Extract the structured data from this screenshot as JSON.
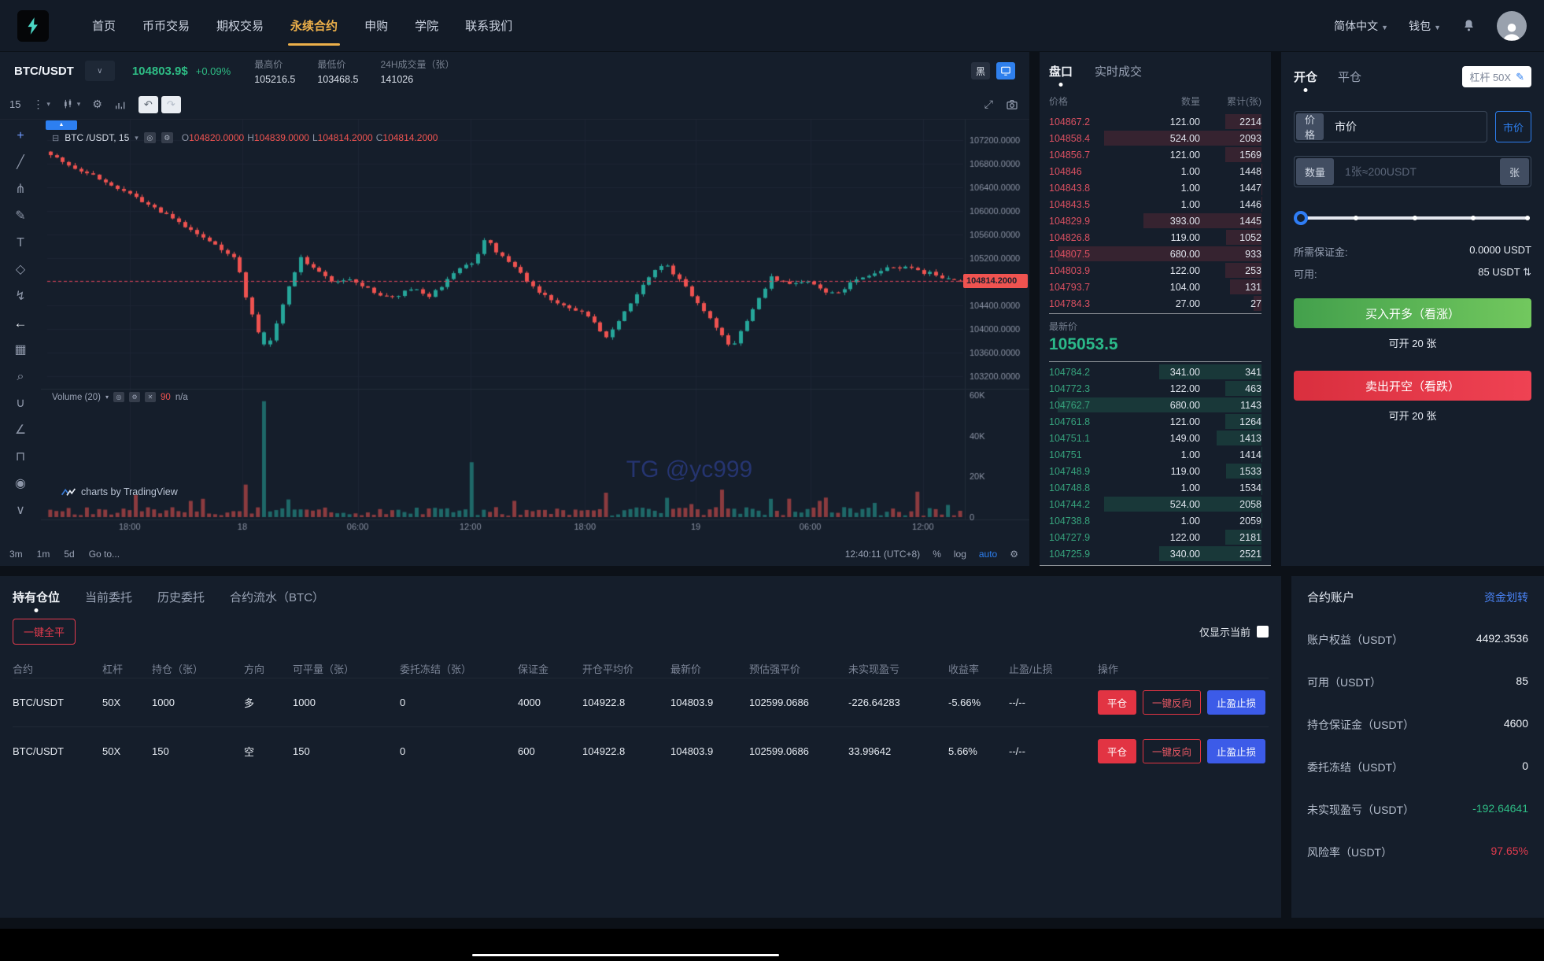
{
  "nav": {
    "items": [
      "首页",
      "币币交易",
      "期权交易",
      "永续合约",
      "申购",
      "学院",
      "联系我们"
    ],
    "active_index": 3,
    "language": "简体中文",
    "wallet": "钱包"
  },
  "symbol_header": {
    "pair": "BTC/USDT",
    "price": "104803.9$",
    "change": "+0.09%",
    "stats": [
      {
        "label": "最高价",
        "value": "105216.5"
      },
      {
        "label": "最低价",
        "value": "103468.5"
      },
      {
        "label": "24H成交量（张）",
        "value": "141026"
      }
    ],
    "theme_toggle": "黑"
  },
  "tv": {
    "interval": "15",
    "legend": {
      "title": "BTC /USDT, 15",
      "ohlc": [
        [
          "O",
          "104820.0000"
        ],
        [
          "H",
          "104839.0000"
        ],
        [
          "L",
          "104814.2000"
        ],
        [
          "C",
          "104814.2000"
        ]
      ]
    },
    "volume_legend": {
      "title": "Volume (20)",
      "value": "90",
      "na": "n/a"
    },
    "attribution": "charts by TradingView",
    "watermark": "TG @yc999",
    "price_tag": "104814.2000",
    "draw_tools": [
      {
        "name": "crosshair-tool-icon",
        "glyph": "+",
        "accent": true
      },
      {
        "name": "trend-line-tool-icon",
        "glyph": "╱"
      },
      {
        "name": "pitchfork-tool-icon",
        "glyph": "⋔"
      },
      {
        "name": "brush-tool-icon",
        "glyph": "✎"
      },
      {
        "name": "text-tool-icon",
        "glyph": "T"
      },
      {
        "name": "shapes-tool-icon",
        "glyph": "◇"
      },
      {
        "name": "forecast-tool-icon",
        "glyph": "↯"
      },
      {
        "name": "back-arrow-icon",
        "glyph": "←",
        "bright": true
      },
      {
        "name": "patterns-tool-icon",
        "glyph": "▦"
      },
      {
        "name": "zoom-tool-icon",
        "glyph": "⌕"
      },
      {
        "name": "magnet-tool-icon",
        "glyph": "∪"
      },
      {
        "name": "measure-tool-icon",
        "glyph": "∠"
      },
      {
        "name": "lock-tool-icon",
        "glyph": "⊓"
      },
      {
        "name": "hide-drawings-icon",
        "glyph": "◉"
      },
      {
        "name": "collapse-toolbar-icon",
        "glyph": "∨"
      }
    ],
    "bottom": {
      "ranges": [
        "3m",
        "1m",
        "5d",
        "Go to..."
      ],
      "clock": "12:40:11 (UTC+8)",
      "percent": "%",
      "log": "log",
      "auto": "auto"
    }
  },
  "chart_data": {
    "type": "candlestick+volume",
    "n_candles": 150,
    "seed": 7,
    "last_price": 104814.2,
    "price_ticks": [
      107200,
      106800,
      106400,
      106000,
      105600,
      105200,
      104800,
      104400,
      104000,
      103600,
      103200
    ],
    "volume_ticks": [
      [
        60000,
        "60K"
      ],
      [
        40000,
        "40K"
      ],
      [
        20000,
        "20K"
      ],
      [
        0,
        "0"
      ]
    ],
    "time_ticks": [
      [
        0.09,
        "18:00"
      ],
      [
        0.213,
        "18"
      ],
      [
        0.339,
        "06:00"
      ],
      [
        0.462,
        "12:00"
      ],
      [
        0.587,
        "18:00"
      ],
      [
        0.708,
        "19"
      ],
      [
        0.833,
        "06:00"
      ],
      [
        0.956,
        "12:00"
      ]
    ],
    "waypoints": [
      [
        0,
        106980
      ],
      [
        0.02,
        106780
      ],
      [
        0.045,
        106600
      ],
      [
        0.07,
        106420
      ],
      [
        0.1,
        106150
      ],
      [
        0.125,
        105950
      ],
      [
        0.155,
        105650
      ],
      [
        0.185,
        105400
      ],
      [
        0.205,
        105150
      ],
      [
        0.215,
        104550
      ],
      [
        0.228,
        103950
      ],
      [
        0.238,
        103650
      ],
      [
        0.25,
        104150
      ],
      [
        0.262,
        104750
      ],
      [
        0.275,
        105200
      ],
      [
        0.295,
        104950
      ],
      [
        0.315,
        104780
      ],
      [
        0.335,
        104820
      ],
      [
        0.355,
        104600
      ],
      [
        0.375,
        104520
      ],
      [
        0.395,
        104700
      ],
      [
        0.415,
        104560
      ],
      [
        0.435,
        104800
      ],
      [
        0.452,
        105080
      ],
      [
        0.465,
        105120
      ],
      [
        0.478,
        105520
      ],
      [
        0.492,
        105260
      ],
      [
        0.515,
        104980
      ],
      [
        0.535,
        104620
      ],
      [
        0.555,
        104480
      ],
      [
        0.575,
        104350
      ],
      [
        0.595,
        104150
      ],
      [
        0.612,
        103850
      ],
      [
        0.628,
        104250
      ],
      [
        0.645,
        104600
      ],
      [
        0.662,
        104950
      ],
      [
        0.675,
        105120
      ],
      [
        0.69,
        104850
      ],
      [
        0.705,
        104550
      ],
      [
        0.72,
        104250
      ],
      [
        0.735,
        103950
      ],
      [
        0.748,
        103680
      ],
      [
        0.762,
        104050
      ],
      [
        0.778,
        104500
      ],
      [
        0.792,
        104880
      ],
      [
        0.81,
        104740
      ],
      [
        0.828,
        104820
      ],
      [
        0.845,
        104700
      ],
      [
        0.862,
        104580
      ],
      [
        0.878,
        104750
      ],
      [
        0.895,
        104900
      ],
      [
        0.912,
        104980
      ],
      [
        0.93,
        105060
      ],
      [
        0.95,
        104990
      ],
      [
        0.968,
        104930
      ],
      [
        0.985,
        104870
      ],
      [
        1,
        104814.2
      ]
    ],
    "volume_spikes": [
      {
        "t": 0.238,
        "v": 57000,
        "up": true
      },
      {
        "t": 0.215,
        "v": 16000,
        "up": false
      },
      {
        "t": 0.17,
        "v": 9000,
        "up": false
      },
      {
        "t": 0.462,
        "v": 27000,
        "up": true
      },
      {
        "t": 0.512,
        "v": 8000,
        "up": false
      },
      {
        "t": 0.612,
        "v": 12000,
        "up": false
      },
      {
        "t": 0.675,
        "v": 9500,
        "up": true
      },
      {
        "t": 0.735,
        "v": 13500,
        "up": false
      },
      {
        "t": 0.792,
        "v": 9000,
        "up": true
      },
      {
        "t": 0.845,
        "v": 8000,
        "up": false
      },
      {
        "t": 0.905,
        "v": 7000,
        "up": true
      },
      {
        "t": 0.955,
        "v": 12500,
        "up": false
      },
      {
        "t": 0.985,
        "v": 6000,
        "up": true
      }
    ],
    "colors": {
      "up": "#26a69a",
      "down": "#ef5350",
      "grid": "#1d2634",
      "axis_text": "#8b93a4",
      "last_line": "#e0435a"
    }
  },
  "orderbook": {
    "tabs": [
      "盘口",
      "实时成交"
    ],
    "columns": [
      "价格",
      "数量",
      "累计(张)"
    ],
    "asks": [
      [
        "104867.2",
        "121.00",
        "2214"
      ],
      [
        "104858.4",
        "524.00",
        "2093"
      ],
      [
        "104856.7",
        "121.00",
        "1569"
      ],
      [
        "104846",
        "1.00",
        "1448"
      ],
      [
        "104843.8",
        "1.00",
        "1447"
      ],
      [
        "104843.5",
        "1.00",
        "1446"
      ],
      [
        "104829.9",
        "393.00",
        "1445"
      ],
      [
        "104826.8",
        "119.00",
        "1052"
      ],
      [
        "104807.5",
        "680.00",
        "933"
      ],
      [
        "104803.9",
        "122.00",
        "253"
      ],
      [
        "104793.7",
        "104.00",
        "131"
      ],
      [
        "104784.3",
        "27.00",
        "27"
      ]
    ],
    "last_label": "最新价",
    "last_price": "105053.5",
    "bids": [
      [
        "104784.2",
        "341.00",
        "341"
      ],
      [
        "104772.3",
        "122.00",
        "463"
      ],
      [
        "104762.7",
        "680.00",
        "1143"
      ],
      [
        "104761.8",
        "121.00",
        "1264"
      ],
      [
        "104751.1",
        "149.00",
        "1413"
      ],
      [
        "104751",
        "1.00",
        "1414"
      ],
      [
        "104748.9",
        "119.00",
        "1533"
      ],
      [
        "104748.8",
        "1.00",
        "1534"
      ],
      [
        "104744.2",
        "524.00",
        "2058"
      ],
      [
        "104738.8",
        "1.00",
        "2059"
      ],
      [
        "104727.9",
        "122.00",
        "2181"
      ],
      [
        "104725.9",
        "340.00",
        "2521"
      ]
    ]
  },
  "trade": {
    "tabs": [
      "开仓",
      "平仓"
    ],
    "leverage": "杠杆 50X",
    "price_label": "价格",
    "price_value": "市价",
    "market_button": "市价",
    "qty_label": "数量",
    "qty_placeholder": "1张≈200USDT",
    "qty_unit": "张",
    "margin_label": "所需保证金:",
    "margin_value": "0.0000 USDT",
    "available_label": "可用:",
    "available_value": "85 USDT",
    "buy_button": "买入开多（看涨）",
    "buy_sub": "可开 20 张",
    "sell_button": "卖出开空（看跌）",
    "sell_sub": "可开 20 张"
  },
  "positions": {
    "tabs": [
      "持有仓位",
      "当前委托",
      "历史委托",
      "合约流水（BTC）"
    ],
    "close_all": "一键全平",
    "only_current": "仅显示当前",
    "headers": [
      "合约",
      "杠杆",
      "持仓（张）",
      "方向",
      "可平量（张）",
      "委托冻结（张）",
      "保证金",
      "开仓平均价",
      "最新价",
      "预估强平价",
      "未实现盈亏",
      "收益率",
      "止盈/止损",
      "操作"
    ],
    "rows": [
      [
        "BTC/USDT",
        "50X",
        "1000",
        "多",
        "1000",
        "0",
        "4000",
        "104922.8",
        "104803.9",
        "102599.0686",
        "-226.64283",
        "-5.66%",
        "--/--"
      ],
      [
        "BTC/USDT",
        "50X",
        "150",
        "空",
        "150",
        "0",
        "600",
        "104922.8",
        "104803.9",
        "102599.0686",
        "33.99642",
        "5.66%",
        "--/--"
      ]
    ],
    "action_labels": [
      "平仓",
      "一键反向",
      "止盈止损"
    ]
  },
  "account": {
    "title": "合约账户",
    "transfer_link": "资金划转",
    "rows": [
      {
        "label": "账户权益（USDT）",
        "value": "4492.3536",
        "tone": ""
      },
      {
        "label": "可用（USDT）",
        "value": "85",
        "tone": ""
      },
      {
        "label": "持仓保证金（USDT）",
        "value": "4600",
        "tone": ""
      },
      {
        "label": "委托冻结（USDT）",
        "value": "0",
        "tone": ""
      },
      {
        "label": "未实现盈亏（USDT）",
        "value": "-192.64641",
        "tone": "green"
      },
      {
        "label": "风险率（USDT）",
        "value": "97.65%",
        "tone": "red"
      }
    ]
  }
}
